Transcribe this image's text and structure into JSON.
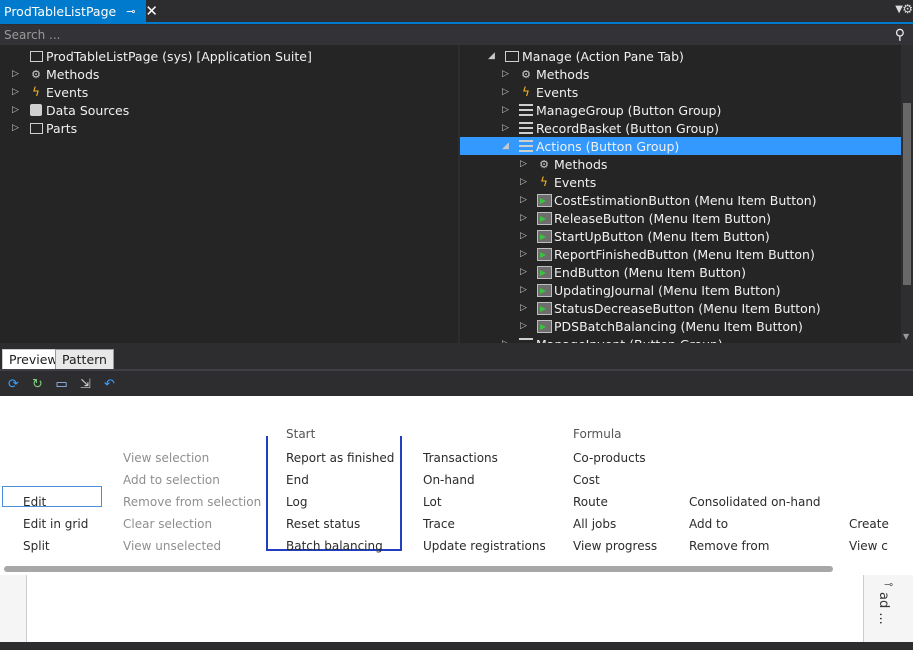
{
  "document_tab": {
    "title": "ProdTableListPage",
    "pin_icon": "pin-icon",
    "close_icon": "close-icon"
  },
  "search": {
    "placeholder": "Search ..."
  },
  "left_tree": [
    {
      "label": "ProdTableListPage (sys) [Application Suite]",
      "icon": "form-icon",
      "expander": ""
    },
    {
      "label": "Methods",
      "icon": "methods-icon",
      "expander": "▷"
    },
    {
      "label": "Events",
      "icon": "events-icon",
      "expander": "▷"
    },
    {
      "label": "Data Sources",
      "icon": "datasource-icon",
      "expander": "▷"
    },
    {
      "label": "Parts",
      "icon": "parts-icon",
      "expander": "▷"
    }
  ],
  "right_tree": [
    {
      "label": "Manage (Action Pane Tab)",
      "icon": "tab-icon",
      "expander": "◢"
    },
    {
      "label": "Methods",
      "icon": "methods-icon",
      "expander": "▷"
    },
    {
      "label": "Events",
      "icon": "events-icon",
      "expander": "▷"
    },
    {
      "label": "ManageGroup (Button Group)",
      "icon": "button-group-icon",
      "expander": "▷"
    },
    {
      "label": "RecordBasket (Button Group)",
      "icon": "button-group-icon",
      "expander": "▷"
    },
    {
      "label": "Actions (Button Group)",
      "icon": "button-group-icon",
      "expander": "◢",
      "selected": true
    },
    {
      "label": "Methods",
      "icon": "methods-icon",
      "expander": "▷"
    },
    {
      "label": "Events",
      "icon": "events-icon",
      "expander": "▷"
    },
    {
      "label": "CostEstimationButton (Menu Item Button)",
      "icon": "menu-item-button-icon",
      "expander": "▷"
    },
    {
      "label": "ReleaseButton (Menu Item Button)",
      "icon": "menu-item-button-icon",
      "expander": "▷"
    },
    {
      "label": "StartUpButton (Menu Item Button)",
      "icon": "menu-item-button-icon",
      "expander": "▷"
    },
    {
      "label": "ReportFinishedButton (Menu Item Button)",
      "icon": "menu-item-button-icon",
      "expander": "▷"
    },
    {
      "label": "EndButton (Menu Item Button)",
      "icon": "menu-item-button-icon",
      "expander": "▷"
    },
    {
      "label": "UpdatingJournal (Menu Item Button)",
      "icon": "menu-item-button-icon",
      "expander": "▷"
    },
    {
      "label": "StatusDecreaseButton (Menu Item Button)",
      "icon": "menu-item-button-icon",
      "expander": "▷"
    },
    {
      "label": "PDSBatchBalancing (Menu Item Button)",
      "icon": "menu-item-button-icon",
      "expander": "▷"
    },
    {
      "label": "ManageInvent (Button Group)",
      "icon": "button-group-icon",
      "expander": "▷"
    }
  ],
  "preview_tabs": {
    "preview": "Preview",
    "pattern": "Pattern"
  },
  "toolbar_icons": [
    "refresh-icon",
    "refresh-all-icon",
    "open-window-icon",
    "export-icon",
    "undo-icon"
  ],
  "action_pane": {
    "col_manage": [
      "Edit",
      "Edit in grid",
      "Split"
    ],
    "col_basket": [
      "View selection",
      "Add to selection",
      "Remove from selection",
      "Clear selection",
      "View unselected"
    ],
    "col_actions": [
      "Start",
      "Report as finished",
      "End",
      "Log",
      "Reset status",
      "Batch balancing"
    ],
    "col_inventory": [
      "Transactions",
      "On-hand",
      "Lot",
      "Trace",
      "Update registrations"
    ],
    "col_production": [
      "Formula",
      "Co-products",
      "Cost",
      "Route",
      "All jobs",
      "View progress"
    ],
    "col_consolidated": [
      "Consolidated on-hand",
      "Add to",
      "Remove from"
    ],
    "col_last": [
      "Create",
      "View c"
    ]
  },
  "side_panel": {
    "label": "ad ...",
    "pin_icon": "pin-icon"
  },
  "colors": {
    "accent": "#007acc",
    "selected": "#3399ff",
    "selection_box": "#2040c0"
  }
}
